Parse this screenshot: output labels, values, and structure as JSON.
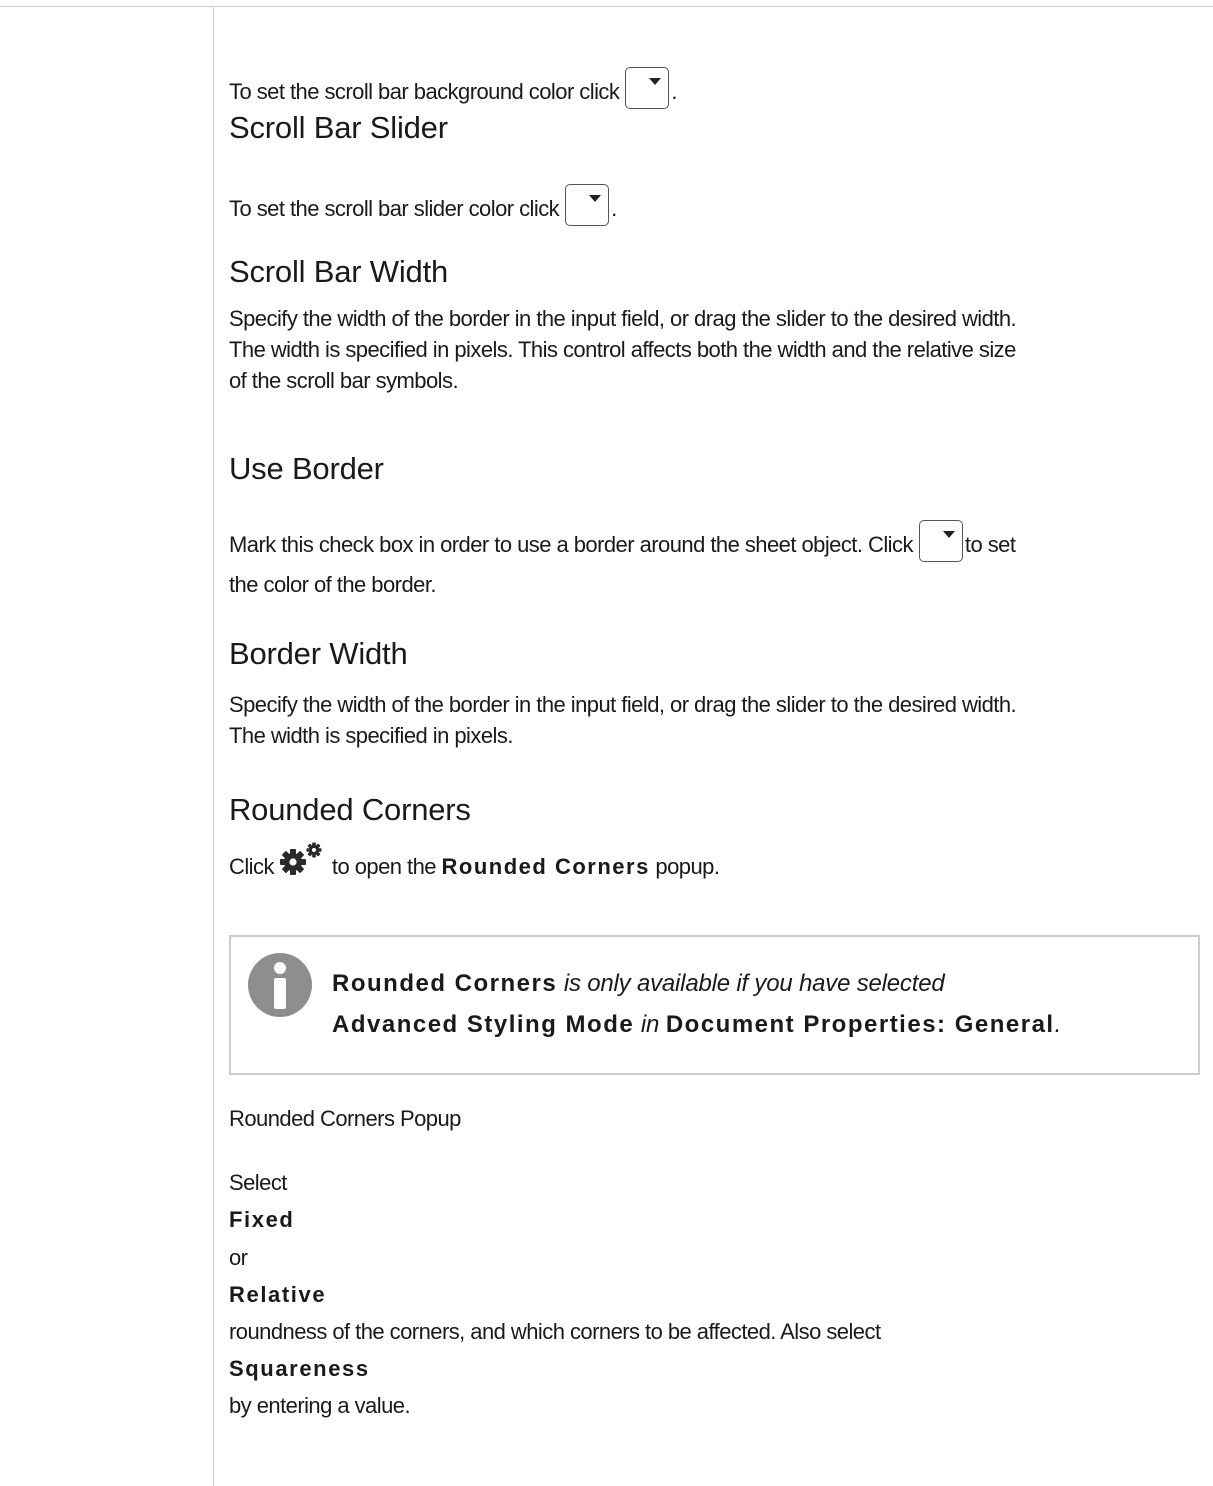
{
  "sections": {
    "bg_line": {
      "before": "To set the scroll bar background color click",
      "after": "."
    },
    "slider": {
      "heading": "Scroll Bar Slider",
      "before": "To set the scroll bar slider color click",
      "after": "."
    },
    "width": {
      "heading": "Scroll Bar Width",
      "line1": "Specify the width of the border in the input field, or drag the slider to the desired width.",
      "line2": "The width is specified in pixels. This control affects both the width and the relative size",
      "line3": "of the scroll bar symbols."
    },
    "use_border": {
      "heading": "Use Border",
      "before": "Mark this check box in order to use a border around the sheet object. Click",
      "after": "to set",
      "line2": "the color of the border."
    },
    "border_width": {
      "heading": "Border Width",
      "line1": "Specify the width of the border in the input field, or drag the slider to the desired width.",
      "line2": "The width is specified in pixels."
    },
    "rounded": {
      "heading": "Rounded Corners",
      "click": "Click",
      "to_open": "to open the",
      "popup_name": "Rounded Corners",
      "popup_word": "popup."
    }
  },
  "note": {
    "bold1": "Rounded Corners",
    "italic1": "is only available if you have selected",
    "bold2": "Advanced Styling Mode",
    "italic2": "in",
    "bold3": "Document Properties: General",
    "end": "."
  },
  "popup": {
    "title": "Rounded Corners Popup",
    "select": "Select",
    "fixed": "Fixed",
    "or": "or",
    "relative": "Relative",
    "roundness": "roundness of the corners, and which corners to be affected. Also select",
    "squareness": "Squareness",
    "by_value": "by entering a value."
  },
  "icons": {
    "dropdown": "dropdown-button-icon",
    "gear": "gear-icon",
    "info": "info-icon"
  },
  "colors": {
    "rule": "#cfcfcf",
    "note_border": "#cdcdcd",
    "info_icon": "#8e8e8e",
    "gear": "#2a2a2a",
    "text": "#1a1a1a"
  }
}
